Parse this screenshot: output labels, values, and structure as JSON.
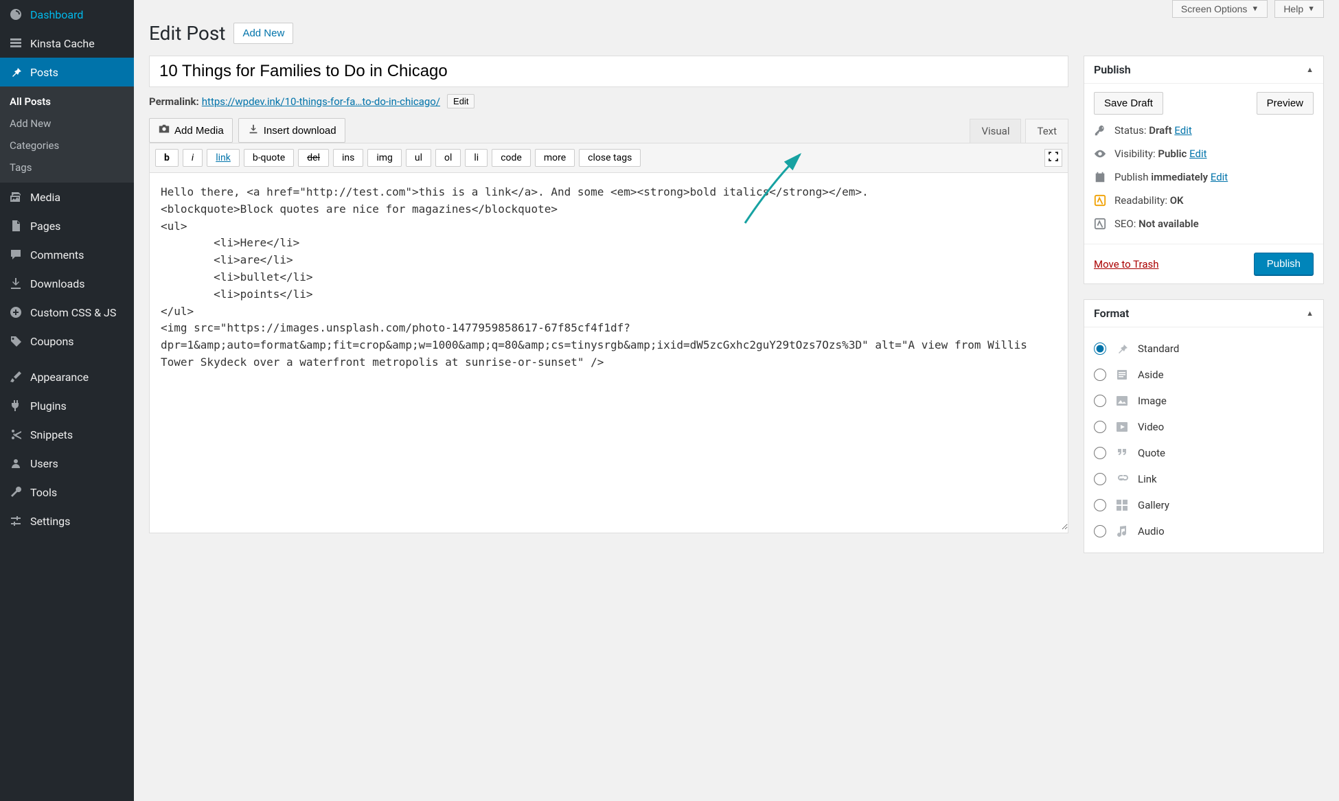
{
  "topbar": {
    "screen_options": "Screen Options",
    "help": "Help"
  },
  "header": {
    "title": "Edit Post",
    "add_new": "Add New"
  },
  "sidebar": {
    "items": [
      {
        "label": "Dashboard",
        "icon": "dashboard"
      },
      {
        "label": "Kinsta Cache",
        "icon": "cache"
      },
      {
        "label": "Posts",
        "icon": "pin",
        "active": true
      },
      {
        "label": "Media",
        "icon": "media"
      },
      {
        "label": "Pages",
        "icon": "pages"
      },
      {
        "label": "Comments",
        "icon": "comments"
      },
      {
        "label": "Downloads",
        "icon": "downloads"
      },
      {
        "label": "Custom CSS & JS",
        "icon": "plus"
      },
      {
        "label": "Coupons",
        "icon": "tag"
      },
      {
        "label": "Appearance",
        "icon": "brush"
      },
      {
        "label": "Plugins",
        "icon": "plug"
      },
      {
        "label": "Snippets",
        "icon": "scissors"
      },
      {
        "label": "Users",
        "icon": "users"
      },
      {
        "label": "Tools",
        "icon": "wrench"
      },
      {
        "label": "Settings",
        "icon": "sliders"
      }
    ],
    "submenu": [
      "All Posts",
      "Add New",
      "Categories",
      "Tags"
    ]
  },
  "post": {
    "title": "10 Things for Families to Do in Chicago",
    "permalink_label": "Permalink:",
    "permalink_base": "https://wpdev.ink/",
    "permalink_slug": "10-things-for-fa…to-do-in-chicago/",
    "edit_label": "Edit"
  },
  "editor": {
    "add_media": "Add Media",
    "insert_download": "Insert download",
    "tab_visual": "Visual",
    "tab_text": "Text",
    "qt_buttons": [
      "b",
      "i",
      "link",
      "b-quote",
      "del",
      "ins",
      "img",
      "ul",
      "ol",
      "li",
      "code",
      "more",
      "close tags"
    ],
    "content": "Hello there, <a href=\"http://test.com\">this is a link</a>. And some <em><strong>bold italics</strong></em>.\n<blockquote>Block quotes are nice for magazines</blockquote>\n<ul>\n \t<li>Here</li>\n \t<li>are</li>\n \t<li>bullet</li>\n \t<li>points</li>\n</ul>\n<img src=\"https://images.unsplash.com/photo-1477959858617-67f85cf4f1df?dpr=1&amp;auto=format&amp;fit=crop&amp;w=1000&amp;q=80&amp;cs=tinysrgb&amp;ixid=dW5zcGxhc2guY29tOzs7Ozs%3D\" alt=\"A view from Willis Tower Skydeck over a waterfront metropolis at sunrise-or-sunset\" />"
  },
  "publish": {
    "title": "Publish",
    "save_draft": "Save Draft",
    "preview": "Preview",
    "status_label": "Status:",
    "status_value": "Draft",
    "visibility_label": "Visibility:",
    "visibility_value": "Public",
    "schedule_label": "Publish",
    "schedule_value": "immediately",
    "readability_label": "Readability:",
    "readability_value": "OK",
    "seo_label": "SEO:",
    "seo_value": "Not available",
    "edit": "Edit",
    "trash": "Move to Trash",
    "publish_btn": "Publish"
  },
  "format": {
    "title": "Format",
    "options": [
      "Standard",
      "Aside",
      "Image",
      "Video",
      "Quote",
      "Link",
      "Gallery",
      "Audio"
    ],
    "selected": "Standard"
  }
}
